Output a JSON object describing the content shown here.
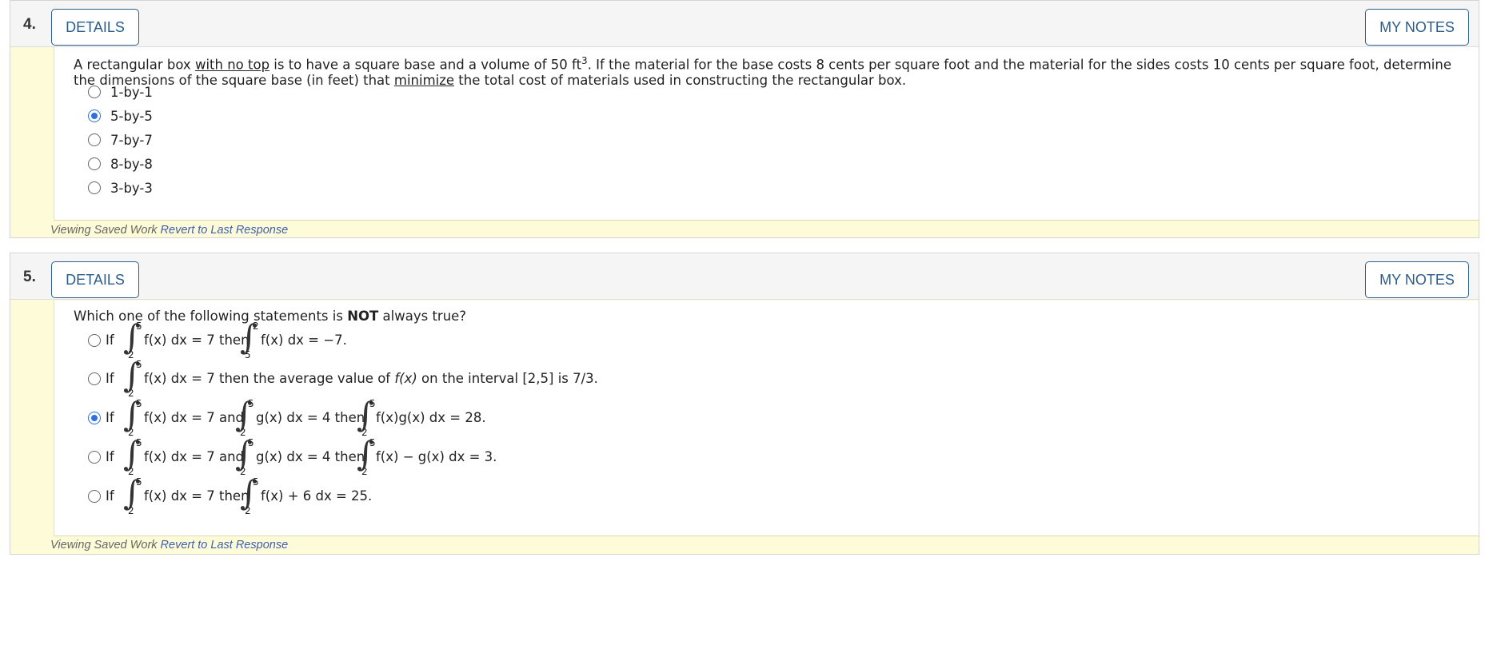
{
  "questions": [
    {
      "number": "4.",
      "details_label": "DETAILS",
      "notes_label": "MY NOTES",
      "text": {
        "p1": "A rectangular box ",
        "u1": "with no top",
        "p2": " is to have a square base and a volume of 50 ft",
        "sup": "3",
        "p3": ". If the material for the base costs 8 cents per square foot and the material for the sides costs 10 cents per square foot, determine the dimensions of the square base (in feet) that ",
        "u2": "minimize",
        "p4": " the total cost of materials used in constructing the rectangular box."
      },
      "options": [
        {
          "label": "1-by-1",
          "checked": false
        },
        {
          "label": "5-by-5",
          "checked": true
        },
        {
          "label": "7-by-7",
          "checked": false
        },
        {
          "label": "8-by-8",
          "checked": false
        },
        {
          "label": "3-by-3",
          "checked": false
        }
      ],
      "footer": {
        "viewing": "Viewing Saved Work ",
        "revert": "Revert to Last Response"
      }
    },
    {
      "number": "5.",
      "details_label": "DETAILS",
      "notes_label": "MY NOTES",
      "text": {
        "p1": "Which one of the following statements is ",
        "bold": "NOT",
        "p2": " always true?"
      },
      "options": [
        {
          "checked": false,
          "if": "If",
          "f1": "f(x) dx = 7 then",
          "f2": "f(x) dx = −7.",
          "upper1": "5",
          "lower1": "2",
          "upper2": "2",
          "lower2": "5"
        },
        {
          "checked": false,
          "if": "If",
          "f1": "f(x) dx = 7 then the average value of ",
          "fx": "f(x)",
          "tail": " on the interval [2,5] is 7/3.",
          "upper1": "5",
          "lower1": "2"
        },
        {
          "checked": true,
          "if": "If",
          "f1": "f(x) dx = 7 and",
          "f2": "g(x) dx = 4 then",
          "f3": "f(x)g(x) dx = 28.",
          "upper1": "5",
          "lower1": "2",
          "upper2": "5",
          "lower2": "2",
          "upper3": "5",
          "lower3": "2"
        },
        {
          "checked": false,
          "if": "If",
          "f1": "f(x) dx = 7 and",
          "f2": "g(x) dx = 4 then",
          "f3": "f(x) − g(x) dx = 3.",
          "upper1": "5",
          "lower1": "2",
          "upper2": "5",
          "lower2": "2",
          "upper3": "5",
          "lower3": "2"
        },
        {
          "checked": false,
          "if": "If",
          "f1": "f(x) dx = 7 then",
          "f2": "f(x) + 6 dx = 25.",
          "upper1": "5",
          "lower1": "2",
          "upper2": "5",
          "lower2": "2"
        }
      ],
      "footer": {
        "viewing": "Viewing Saved Work ",
        "revert": "Revert to Last Response"
      }
    }
  ],
  "colors": {
    "accent": "#2b5d8c",
    "radio_checked": "#2f6fe0",
    "footer_bg": "#fefcd8",
    "link": "#3e5fb0"
  }
}
